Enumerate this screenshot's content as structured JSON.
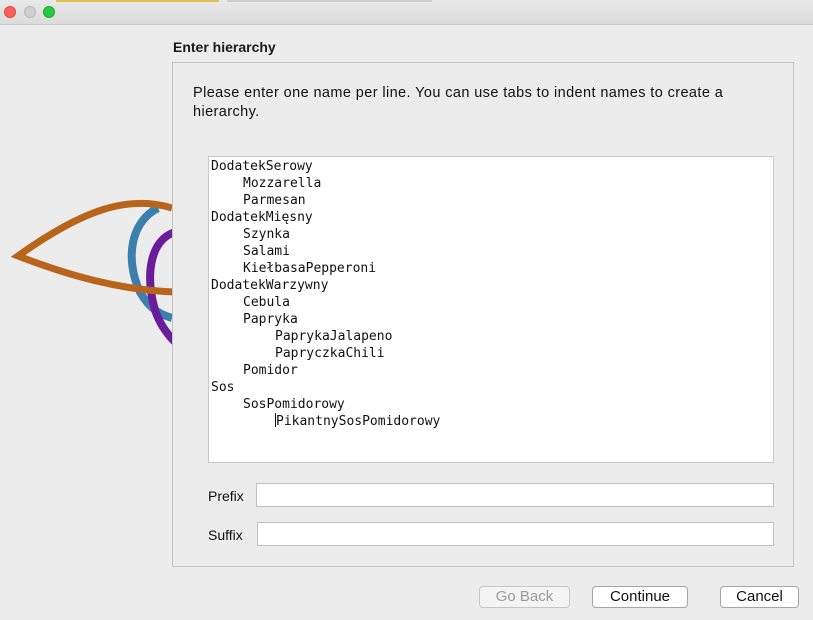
{
  "section_title": "Enter hierarchy",
  "instructions": "Please enter one name per line.  You can use tabs to indent names to create a hierarchy.",
  "hierarchy": [
    {
      "text": "DodatekSerowy",
      "level": 0
    },
    {
      "text": "Mozzarella",
      "level": 1
    },
    {
      "text": "Parmesan",
      "level": 1
    },
    {
      "text": "DodatekMięsny",
      "level": 0
    },
    {
      "text": "Szynka",
      "level": 1
    },
    {
      "text": "Salami",
      "level": 1
    },
    {
      "text": "KiełbasaPepperoni",
      "level": 1
    },
    {
      "text": "DodatekWarzywny",
      "level": 0
    },
    {
      "text": "Cebula",
      "level": 1
    },
    {
      "text": "Papryka",
      "level": 1
    },
    {
      "text": "PaprykaJalapeno",
      "level": 2
    },
    {
      "text": "PapryczkaChili",
      "level": 2
    },
    {
      "text": "Pomidor",
      "level": 1
    },
    {
      "text": "Sos",
      "level": 0
    },
    {
      "text": "SosPomidorowy",
      "level": 1
    },
    {
      "text": "PikantnySosPomidorowy",
      "level": 2
    }
  ],
  "prefix": {
    "label": "Prefix",
    "value": ""
  },
  "suffix": {
    "label": "Suffix",
    "value": ""
  },
  "buttons": {
    "go_back": "Go Back",
    "continue": "Continue",
    "cancel": "Cancel"
  },
  "colors": {
    "logo_orange": "#b8651b",
    "logo_blue": "#3a7fad",
    "logo_purple": "#6a1c9a",
    "traffic_close": "#fe5f57",
    "traffic_zoom": "#28c840"
  }
}
